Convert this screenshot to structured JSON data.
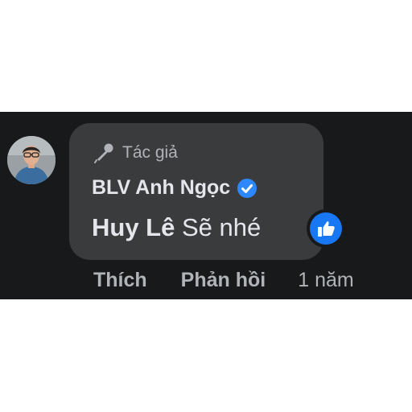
{
  "comment": {
    "author_badge_label": "Tác giả",
    "author_badge_icon": "microphone-icon",
    "author_name": "BLV Anh Ngọc",
    "verified_icon": "verified-check-icon",
    "mention": "Huy Lê",
    "text": " Sẽ nhé",
    "reaction_icon": "thumbs-up-icon",
    "colors": {
      "background": "#18191a",
      "bubble": "#3a3b3c",
      "text_primary": "#e4e6eb",
      "text_secondary": "#b0b3b8",
      "accent": "#1877f2"
    }
  },
  "actions": {
    "like_label": "Thích",
    "reply_label": "Phản hồi",
    "timestamp": "1 năm"
  }
}
